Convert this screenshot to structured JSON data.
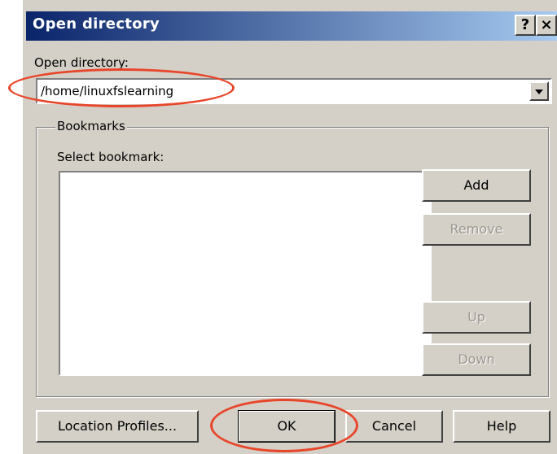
{
  "window": {
    "title": "Open directory",
    "help_glyph": "?",
    "close_glyph": "×"
  },
  "directory": {
    "label": "Open directory:",
    "value": "/home/linuxfslearning"
  },
  "bookmarks": {
    "group_label": "Bookmarks",
    "select_label": "Select bookmark:",
    "items": [],
    "buttons": {
      "add": "Add",
      "remove": "Remove",
      "up": "Up",
      "down": "Down"
    }
  },
  "footer": {
    "location_profiles": "Location Profiles...",
    "ok": "OK",
    "cancel": "Cancel",
    "help": "Help"
  },
  "colors": {
    "annotation": "#e8462a",
    "titlebar_start": "#0a246a",
    "dialog_face": "#d4d0c8"
  }
}
